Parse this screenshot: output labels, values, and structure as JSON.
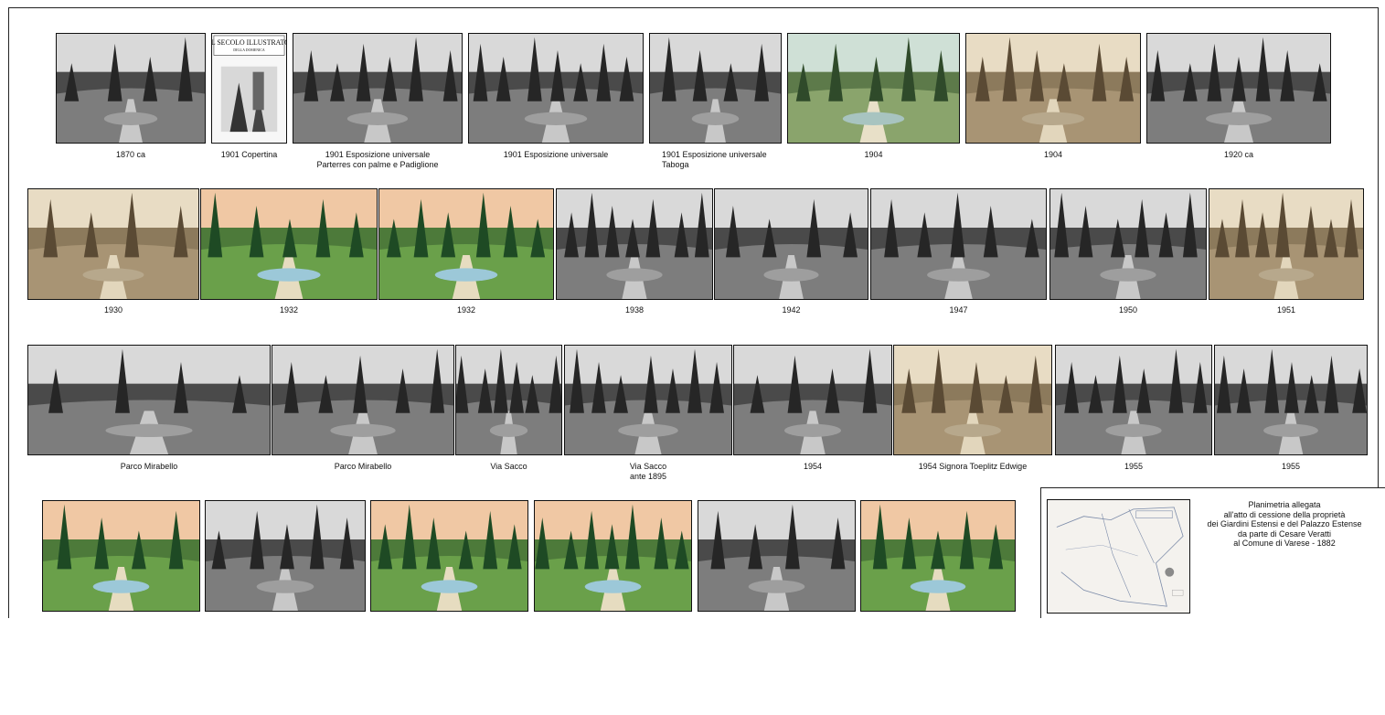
{
  "rows": [
    {
      "photos": [
        {
          "caption": [
            "1870 ca"
          ]
        },
        {
          "caption": [
            "1901 Copertina"
          ],
          "title_lines": [
            "IL SECOLO ILLUSTRATO",
            "DELLA DOMENICA"
          ]
        },
        {
          "caption": [
            "1901 Esposizione universale",
            "Parterres con palme e Padiglione"
          ]
        },
        {
          "caption": [
            "1901 Esposizione universale"
          ]
        },
        {
          "caption": [
            "1901 Esposizione universale",
            "Taboga"
          ]
        },
        {
          "caption": [
            "1904"
          ]
        },
        {
          "caption": [
            "1904"
          ]
        },
        {
          "caption": [
            "1920 ca"
          ]
        }
      ]
    },
    {
      "photos": [
        {
          "caption": [
            "1930"
          ]
        },
        {
          "caption": [
            "1932"
          ]
        },
        {
          "caption": [
            "1932"
          ]
        },
        {
          "caption": [
            "1938"
          ]
        },
        {
          "caption": [
            "1942"
          ]
        },
        {
          "caption": [
            "1947"
          ]
        },
        {
          "caption": [
            "1950"
          ]
        },
        {
          "caption": [
            "1951"
          ]
        }
      ]
    },
    {
      "photos": [
        {
          "caption": [
            "Parco Mirabello"
          ]
        },
        {
          "caption": [
            "Parco Mirabello"
          ]
        },
        {
          "caption": [
            "Via Sacco"
          ]
        },
        {
          "caption": [
            "Via Sacco",
            "ante 1895"
          ]
        },
        {
          "caption": [
            "1954"
          ]
        },
        {
          "caption": [
            "1954  Signora Toeplitz Edwige"
          ]
        },
        {
          "caption": [
            "1955"
          ]
        },
        {
          "caption": [
            "1955"
          ]
        }
      ]
    },
    {
      "photos": [
        {
          "caption": []
        },
        {
          "caption": []
        },
        {
          "caption": []
        },
        {
          "caption": []
        },
        {
          "caption": []
        },
        {
          "caption": []
        }
      ]
    }
  ],
  "plan": {
    "text_lines": [
      "Planimetria allegata",
      "all'atto di cessione della proprietà",
      "dei Giardini Estensi e del Palazzo Estense",
      "da parte di Cesare Veratti",
      "al Comune di Varese - 1882"
    ]
  },
  "colors": {
    "sepia": "#b8a27e",
    "bw_dark": "#3a3a3a",
    "green": "#3f6b2f",
    "sky": "#9fc6d8"
  }
}
